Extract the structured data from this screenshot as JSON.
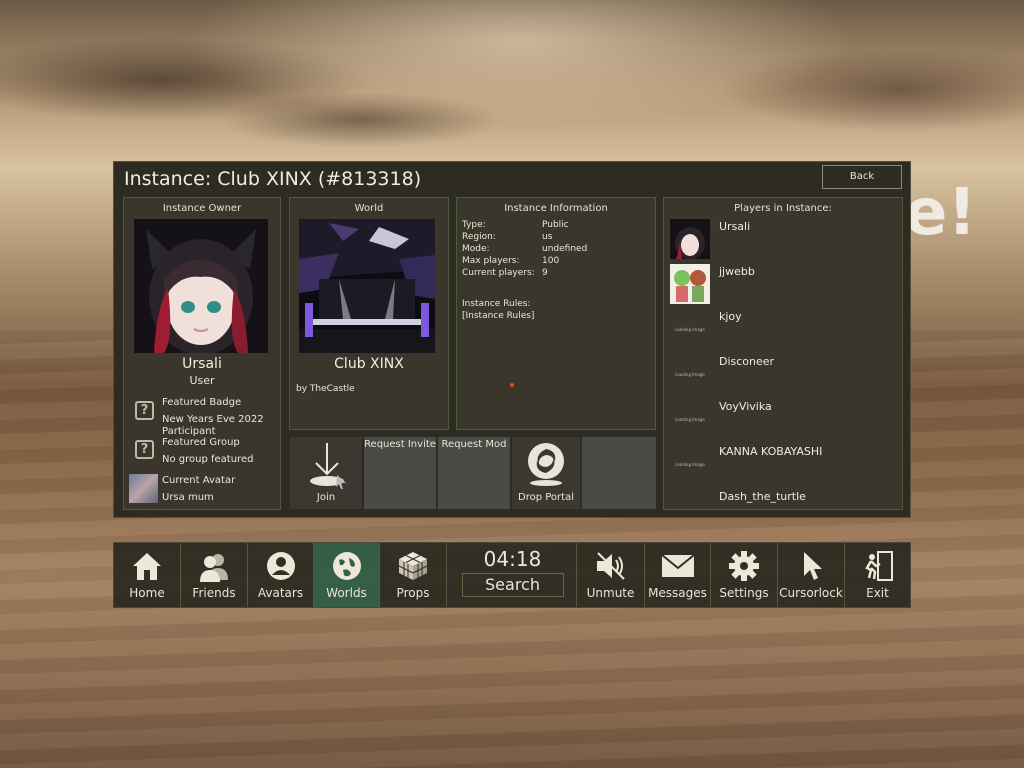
{
  "panel": {
    "title": "Instance: Club XINX (#813318)",
    "back_label": "Back"
  },
  "owner": {
    "header": "Instance Owner",
    "name": "Ursali",
    "role": "User",
    "featured_badge_label": "Featured Badge",
    "featured_badge_value": "New Years Eve 2022 Participant",
    "featured_group_label": "Featured Group",
    "featured_group_value": "No group featured",
    "current_avatar_label": "Current Avatar",
    "current_avatar_value": "Ursa mum"
  },
  "world": {
    "header": "World",
    "name": "Club XINX",
    "author": "by TheCastle"
  },
  "instance_info": {
    "header": "Instance Information",
    "rows": [
      {
        "key": "Type:",
        "value": "Public"
      },
      {
        "key": "Region:",
        "value": "us"
      },
      {
        "key": "Mode:",
        "value": "undefined"
      },
      {
        "key": "Max players:",
        "value": "100"
      },
      {
        "key": "Current players:",
        "value": "9"
      }
    ],
    "rules_label": "Instance Rules:",
    "rules_value": "[Instance Rules]"
  },
  "actions": {
    "join": "Join",
    "request_invite": "Request Invite",
    "request_mod": "Request Mod",
    "drop_portal": "Drop Portal"
  },
  "players": {
    "header": "Players in Instance:",
    "loading_text": "Loading Image",
    "list": [
      {
        "name": "Ursali"
      },
      {
        "name": "jjwebb"
      },
      {
        "name": "kjoy"
      },
      {
        "name": "Disconeer"
      },
      {
        "name": "VoyVivika"
      },
      {
        "name": "KANNA KOBAYASHI"
      },
      {
        "name": "Dash_the_turtle"
      }
    ]
  },
  "menu": {
    "home": "Home",
    "friends": "Friends",
    "avatars": "Avatars",
    "worlds": "Worlds",
    "props": "Props",
    "time": "04:18",
    "search": "Search",
    "unmute": "Unmute",
    "messages": "Messages",
    "settings": "Settings",
    "cursorlock": "Cursorlock",
    "exit": "Exit"
  },
  "colors": {
    "panel_bg": "#2e2b22",
    "active_tab": "#2f5e45",
    "border_accent": "#4e5a3c"
  }
}
